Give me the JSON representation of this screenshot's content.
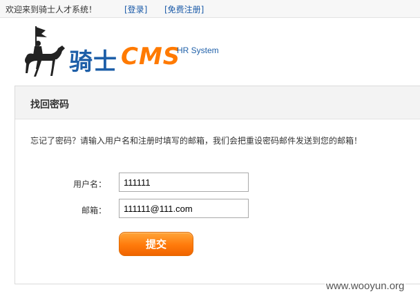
{
  "topbar": {
    "welcome": "欢迎来到骑士人才系统！",
    "login": "[登录]",
    "register": "[免费注册]"
  },
  "logo": {
    "brand": "骑士",
    "cms": "CMS",
    "tagline": "HR System",
    "icon": "horse-rider-icon"
  },
  "panel": {
    "title": "找回密码",
    "description": "忘记了密码？请输入用户名和注册时填写的邮箱，我们会把重设密码邮件发送到您的邮箱！",
    "username_label": "用户名：",
    "username_value": "111111",
    "email_label": "邮箱：",
    "email_value": "111111@111.com",
    "submit_label": "提交"
  },
  "watermark": "www.wooyun.org",
  "colors": {
    "link": "#1a5aa8",
    "brand_blue": "#1e5fa8",
    "brand_orange": "#ff7a00",
    "button": "#ff7a0b"
  }
}
